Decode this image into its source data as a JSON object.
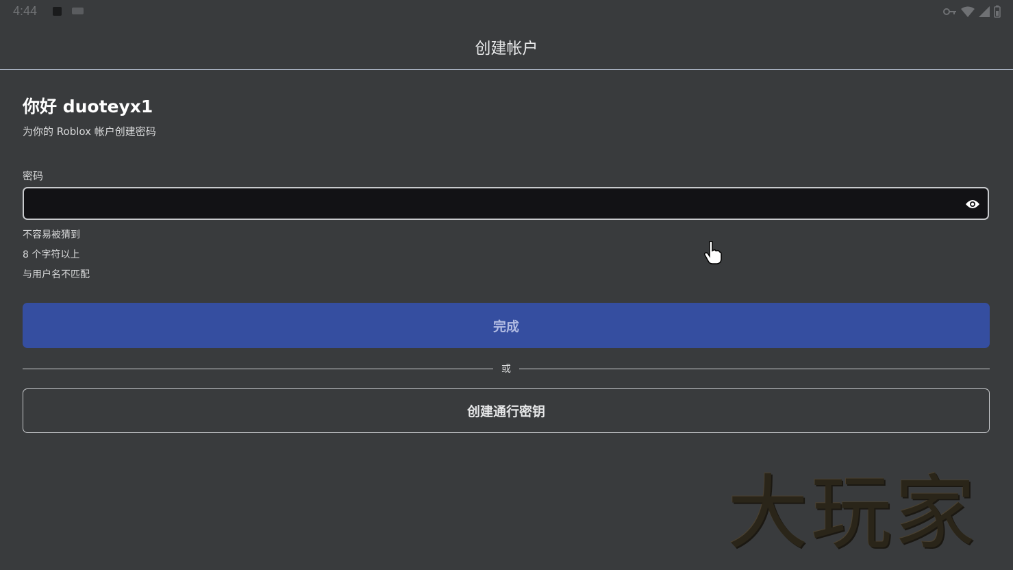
{
  "status_bar": {
    "time": "4:44"
  },
  "header": {
    "title": "创建帐户"
  },
  "main": {
    "greeting": "你好 duoteyx1",
    "subtitle": "为你的 Roblox 帐户创建密码",
    "password_label": "密码",
    "password_value": "",
    "requirements": [
      "不容易被猜到",
      "8 个字符以上",
      "与用户名不匹配"
    ],
    "done_button": "完成",
    "divider_text": "或",
    "passkey_button": "创建通行密钥"
  },
  "watermark": "大玩家",
  "colors": {
    "background": "#393b3d",
    "input_background": "#121215",
    "primary_button": "#354ea0",
    "primary_button_text": "#b3bde3"
  }
}
